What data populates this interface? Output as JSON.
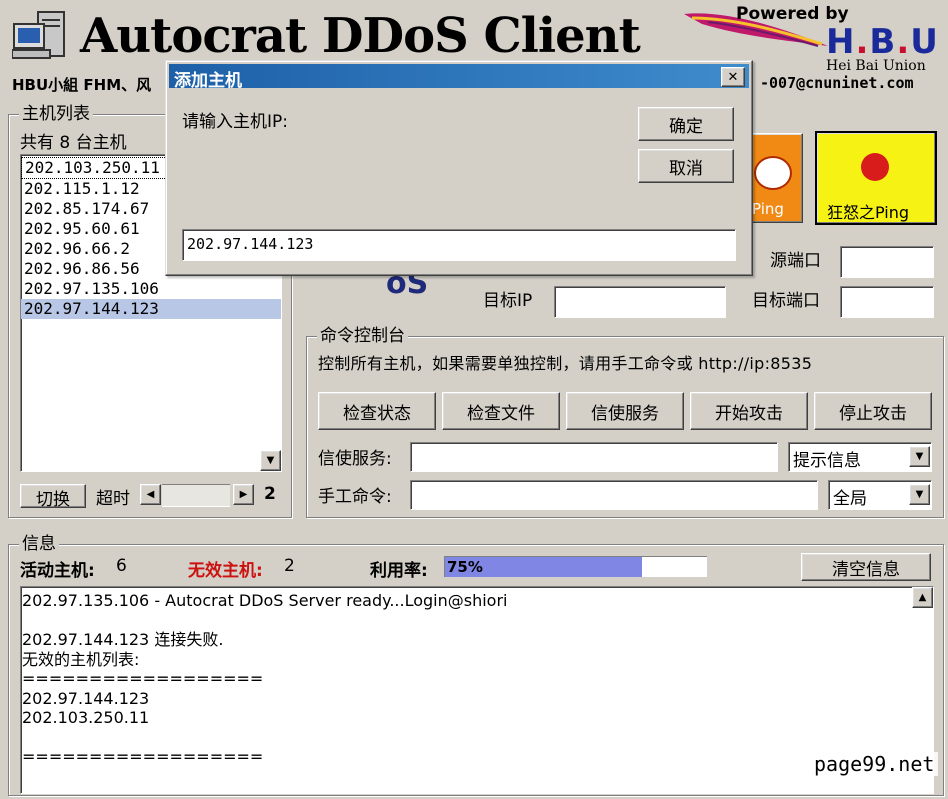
{
  "header": {
    "title": "Autocrat DDoS Client",
    "subtitle": "HBU小組 FHM、风",
    "email": "-007@cnuninet.com",
    "powered_by": "Powered by",
    "brand_h": "H",
    "brand_b": "B",
    "brand_u": "U",
    "brand_dot": ".",
    "brand_sub": "Hei Bai Union"
  },
  "host_panel": {
    "title": "主机列表",
    "count_label": "共有 8 台主机",
    "hosts": [
      "202.103.250.11",
      "202.115.1.12",
      "202.85.174.67",
      "202.95.60.61",
      "202.96.66.2",
      "202.96.86.56",
      "202.97.135.106",
      "202.97.144.123"
    ],
    "switch_button": "切换",
    "timeout_label": "超时",
    "timeout_value": "2"
  },
  "ping_buttons": {
    "ping_partial_label": "Ping",
    "rage_ping_label": "狂怒之Ping"
  },
  "ddos_partial": "oS",
  "target": {
    "source_port_label": "源端口",
    "target_ip_label": "目标IP",
    "target_port_label": "目标端口",
    "source_port_value": "",
    "target_ip_value": "",
    "target_port_value": ""
  },
  "console": {
    "title": "命令控制台",
    "description": "控制所有主机，如果需要单独控制，请用手工命令或 http://ip:8535",
    "buttons": [
      "检查状态",
      "检查文件",
      "信使服务",
      "开始攻击",
      "停止攻击"
    ],
    "messenger_label": "信使服务:",
    "messenger_value": "",
    "messenger_select": "提示信息",
    "manual_label": "手工命令:",
    "manual_value": "",
    "manual_select": "全局"
  },
  "info": {
    "title": "信息",
    "active_label": "活动主机:",
    "active_value": "6",
    "invalid_label": "无效主机:",
    "invalid_value": "2",
    "usage_label": "利用率:",
    "usage_value": "75%",
    "usage_percent": 75,
    "clear_button": "清空信息",
    "log": [
      "202.97.135.106 - Autocrat DDoS Server ready...Login@shiori",
      "",
      "202.97.144.123 连接失败.",
      "无效的主机列表:",
      "==================",
      "202.97.144.123",
      "202.103.250.11",
      "",
      "=================="
    ]
  },
  "dialog": {
    "title": "添加主机",
    "prompt": "请输入主机IP:",
    "ok_button": "确定",
    "cancel_button": "取消",
    "ip_value": "202.97.144.123",
    "close_glyph": "✕"
  },
  "watermark": "page99.net",
  "colors": {
    "selection": "#b9c7e6",
    "progress": "#7f86e4",
    "invalid": "#cc1111",
    "title_bar": "#1d60a8",
    "rage_button": "#f6f214",
    "orange_button": "#f08a14"
  }
}
